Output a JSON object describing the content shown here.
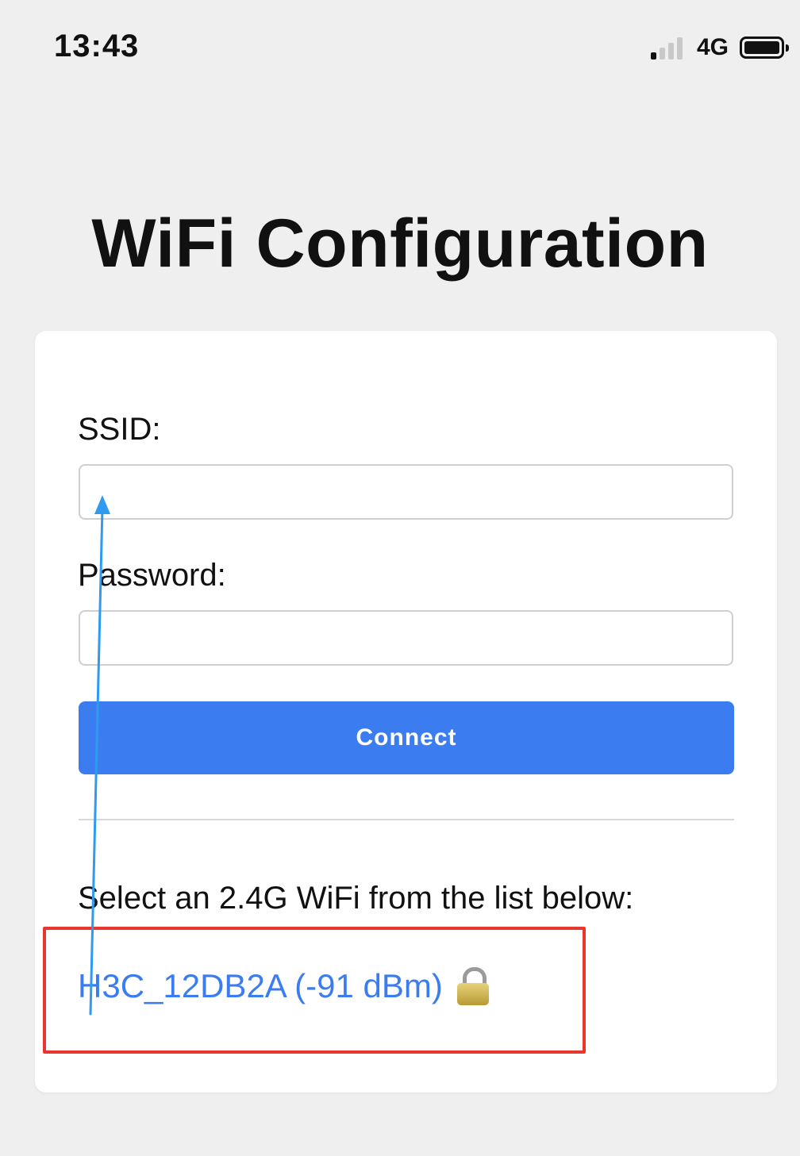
{
  "status_bar": {
    "time": "13:43",
    "network": "4G",
    "signal_bars": 1,
    "battery_level": 1.0
  },
  "page": {
    "title": "WiFi Configuration"
  },
  "form": {
    "ssid_label": "SSID:",
    "ssid_value": "",
    "password_label": "Password:",
    "password_value": "",
    "connect_label": "Connect"
  },
  "network_list": {
    "instruction": "Select an 2.4G WiFi from the list below:",
    "items": [
      {
        "label": "H3C_12DB2A (-91 dBm)",
        "icon": "lock-icon"
      }
    ]
  },
  "annotations": {
    "highlight_color": "#e8362f",
    "arrow_color": "#2e9bf0"
  },
  "colors": {
    "accent": "#3b7df0",
    "background": "#efefef",
    "card": "#ffffff"
  }
}
